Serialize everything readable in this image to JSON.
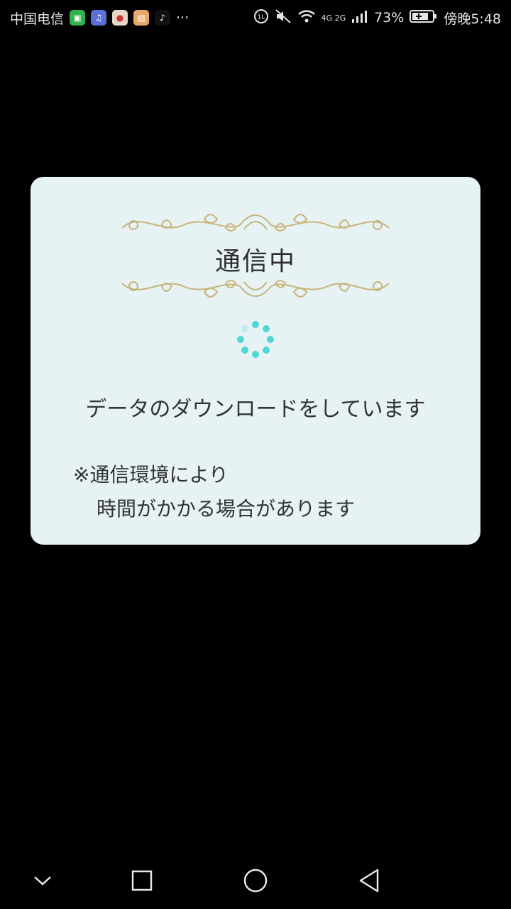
{
  "status_bar": {
    "carrier": "中国电信",
    "more_indicator": "···",
    "network": "4G 2G",
    "battery_percent": "73%",
    "time": "傍晚5:48",
    "app_icons": [
      "iqiyi-icon",
      "music-icon",
      "map-icon",
      "reader-icon",
      "tiktok-icon"
    ]
  },
  "dialog": {
    "title": "通信中",
    "message": "データのダウンロードをしています",
    "note_line1": "※通信環境により",
    "note_line2": "時間がかかる場合があります",
    "accent_color": "#4fd6d6",
    "ornament_color": "#c6b67a"
  },
  "nav": {
    "items": [
      "collapse-icon",
      "recent-apps-icon",
      "home-icon",
      "back-icon"
    ]
  }
}
